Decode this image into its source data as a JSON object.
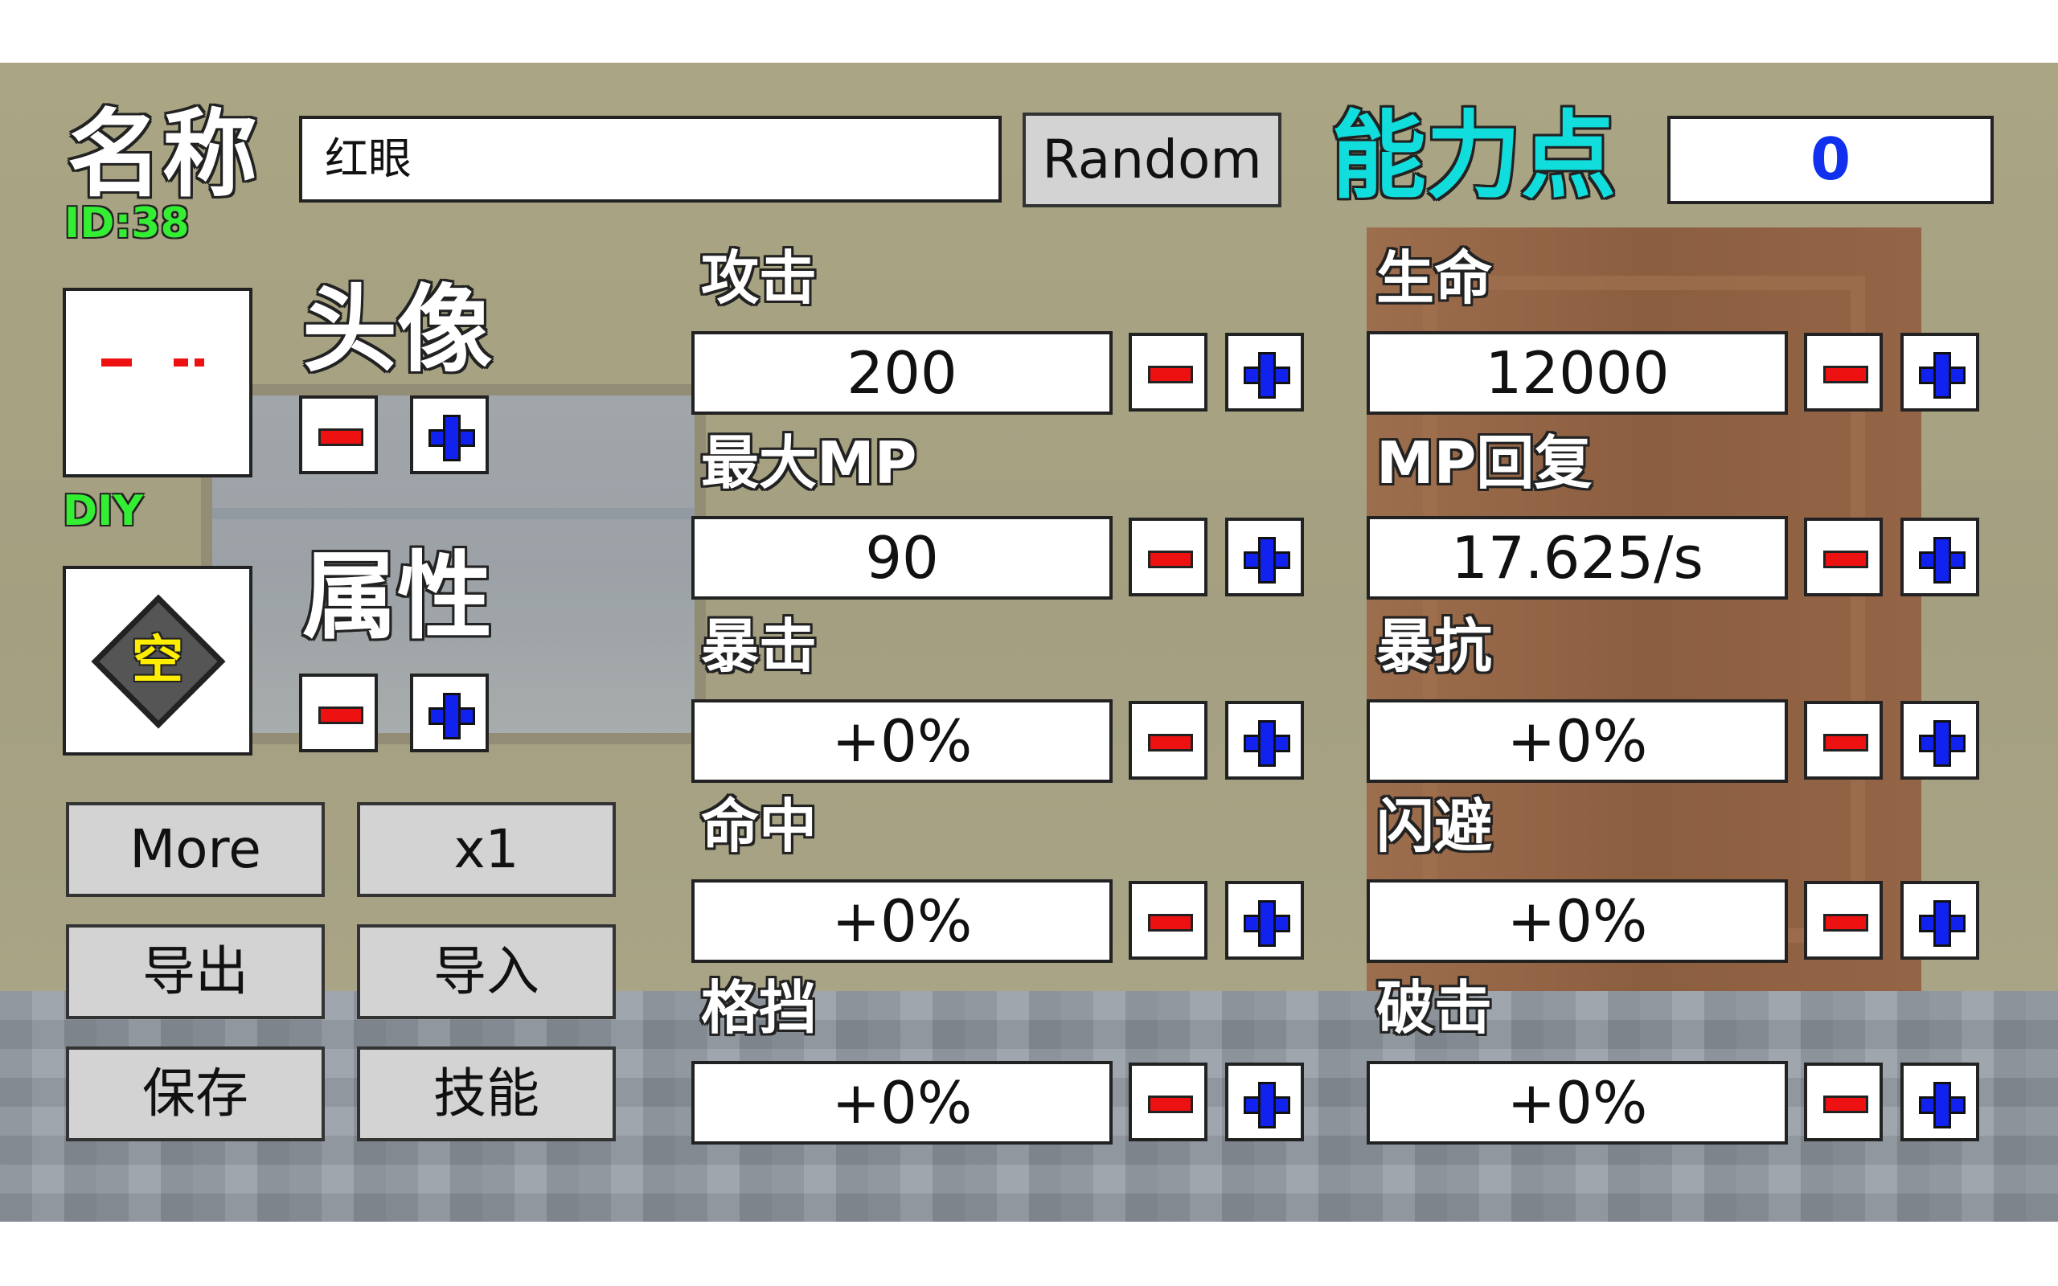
{
  "header": {
    "name_label": "名称",
    "id_label": "ID:38",
    "name_value": "红眼",
    "random_label": "Random",
    "points_label": "能力点",
    "points_value": "0"
  },
  "left": {
    "avatar_label": "头像",
    "diy_label": "DIY",
    "attribute_label": "属性",
    "attribute_icon_text": "空",
    "buttons": {
      "more": "More",
      "multiplier": "x1",
      "export": "导出",
      "import": "导入",
      "save": "保存",
      "skills": "技能"
    }
  },
  "stats": [
    {
      "label": "攻击",
      "value": "200"
    },
    {
      "label": "生命",
      "value": "12000"
    },
    {
      "label": "最大MP",
      "value": "90"
    },
    {
      "label": "MP回复",
      "value": "17.625/s"
    },
    {
      "label": "暴击",
      "value": "+0%"
    },
    {
      "label": "暴抗",
      "value": "+0%"
    },
    {
      "label": "命中",
      "value": "+0%"
    },
    {
      "label": "闪避",
      "value": "+0%"
    },
    {
      "label": "格挡",
      "value": "+0%"
    },
    {
      "label": "破击",
      "value": "+0%"
    }
  ],
  "colors": {
    "points_label": "#11dddd",
    "points_value": "#1030ee",
    "id_text": "#33ee33",
    "minus": "#ee1111",
    "plus": "#1122ee"
  },
  "icons": {
    "minus": "minus-icon",
    "plus": "plus-icon",
    "attribute": "diamond-icon"
  }
}
